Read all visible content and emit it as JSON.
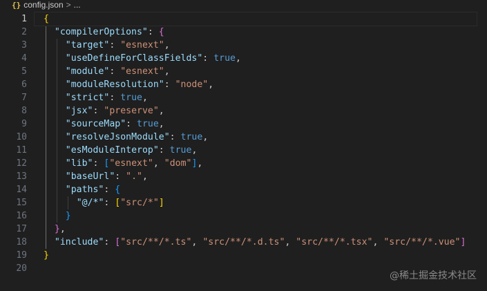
{
  "breadcrumb": {
    "file_icon": "{}",
    "file_name": "config.json",
    "separator": ">",
    "more": "..."
  },
  "editor": {
    "current_line": 1,
    "lines": [
      {
        "n": "1",
        "indent": 0,
        "tokens": [
          [
            "br1",
            "{"
          ]
        ]
      },
      {
        "n": "2",
        "indent": 1,
        "tokens": [
          [
            "k",
            "\"compilerOptions\""
          ],
          [
            "p",
            ": "
          ],
          [
            "br2",
            "{"
          ]
        ]
      },
      {
        "n": "3",
        "indent": 2,
        "tokens": [
          [
            "k",
            "\"target\""
          ],
          [
            "p",
            ": "
          ],
          [
            "s",
            "\"esnext\""
          ],
          [
            "p",
            ","
          ]
        ]
      },
      {
        "n": "4",
        "indent": 2,
        "tokens": [
          [
            "k",
            "\"useDefineForClassFields\""
          ],
          [
            "p",
            ": "
          ],
          [
            "b",
            "true"
          ],
          [
            "p",
            ","
          ]
        ]
      },
      {
        "n": "5",
        "indent": 2,
        "tokens": [
          [
            "k",
            "\"module\""
          ],
          [
            "p",
            ": "
          ],
          [
            "s",
            "\"esnext\""
          ],
          [
            "p",
            ","
          ]
        ]
      },
      {
        "n": "6",
        "indent": 2,
        "tokens": [
          [
            "k",
            "\"moduleResolution\""
          ],
          [
            "p",
            ": "
          ],
          [
            "s",
            "\"node\""
          ],
          [
            "p",
            ","
          ]
        ]
      },
      {
        "n": "7",
        "indent": 2,
        "tokens": [
          [
            "k",
            "\"strict\""
          ],
          [
            "p",
            ": "
          ],
          [
            "b",
            "true"
          ],
          [
            "p",
            ","
          ]
        ]
      },
      {
        "n": "8",
        "indent": 2,
        "tokens": [
          [
            "k",
            "\"jsx\""
          ],
          [
            "p",
            ": "
          ],
          [
            "s",
            "\"preserve\""
          ],
          [
            "p",
            ","
          ]
        ]
      },
      {
        "n": "9",
        "indent": 2,
        "tokens": [
          [
            "k",
            "\"sourceMap\""
          ],
          [
            "p",
            ": "
          ],
          [
            "b",
            "true"
          ],
          [
            "p",
            ","
          ]
        ]
      },
      {
        "n": "10",
        "indent": 2,
        "tokens": [
          [
            "k",
            "\"resolveJsonModule\""
          ],
          [
            "p",
            ": "
          ],
          [
            "b",
            "true"
          ],
          [
            "p",
            ","
          ]
        ]
      },
      {
        "n": "11",
        "indent": 2,
        "tokens": [
          [
            "k",
            "\"esModuleInterop\""
          ],
          [
            "p",
            ": "
          ],
          [
            "b",
            "true"
          ],
          [
            "p",
            ","
          ]
        ]
      },
      {
        "n": "12",
        "indent": 2,
        "tokens": [
          [
            "k",
            "\"lib\""
          ],
          [
            "p",
            ": "
          ],
          [
            "br3",
            "["
          ],
          [
            "s",
            "\"esnext\""
          ],
          [
            "p",
            ", "
          ],
          [
            "s",
            "\"dom\""
          ],
          [
            "br3",
            "]"
          ],
          [
            "p",
            ","
          ]
        ]
      },
      {
        "n": "13",
        "indent": 2,
        "tokens": [
          [
            "k",
            "\"baseUrl\""
          ],
          [
            "p",
            ": "
          ],
          [
            "s",
            "\".\""
          ],
          [
            "p",
            ","
          ]
        ]
      },
      {
        "n": "14",
        "indent": 2,
        "tokens": [
          [
            "k",
            "\"paths\""
          ],
          [
            "p",
            ": "
          ],
          [
            "br3",
            "{"
          ]
        ]
      },
      {
        "n": "15",
        "indent": 3,
        "tokens": [
          [
            "k",
            "\"@/*\""
          ],
          [
            "p",
            ": "
          ],
          [
            "br1",
            "["
          ],
          [
            "s",
            "\"src/*\""
          ],
          [
            "br1",
            "]"
          ]
        ]
      },
      {
        "n": "16",
        "indent": 2,
        "tokens": [
          [
            "br3",
            "}"
          ]
        ]
      },
      {
        "n": "17",
        "indent": 1,
        "tokens": [
          [
            "br2",
            "}"
          ],
          [
            "p",
            ","
          ]
        ]
      },
      {
        "n": "18",
        "indent": 1,
        "tokens": [
          [
            "k",
            "\"include\""
          ],
          [
            "p",
            ": "
          ],
          [
            "br2",
            "["
          ],
          [
            "s",
            "\"src/**/*.ts\""
          ],
          [
            "p",
            ", "
          ],
          [
            "s",
            "\"src/**/*.d.ts\""
          ],
          [
            "p",
            ", "
          ],
          [
            "s",
            "\"src/**/*.tsx\""
          ],
          [
            "p",
            ", "
          ],
          [
            "s",
            "\"src/**/*.vue\""
          ],
          [
            "br2",
            "]"
          ]
        ]
      },
      {
        "n": "19",
        "indent": 0,
        "tokens": [
          [
            "br1",
            "}"
          ]
        ]
      },
      {
        "n": "20",
        "indent": 0,
        "tokens": []
      }
    ]
  },
  "colors": {
    "background": "#1f1f1f",
    "key": "#9cdcfe",
    "string": "#ce9178",
    "boolean": "#569cd6",
    "bracket_level1": "#ffd700",
    "bracket_level2": "#da70d6",
    "bracket_level3": "#179fff"
  },
  "watermark": "@稀土掘金技术社区"
}
